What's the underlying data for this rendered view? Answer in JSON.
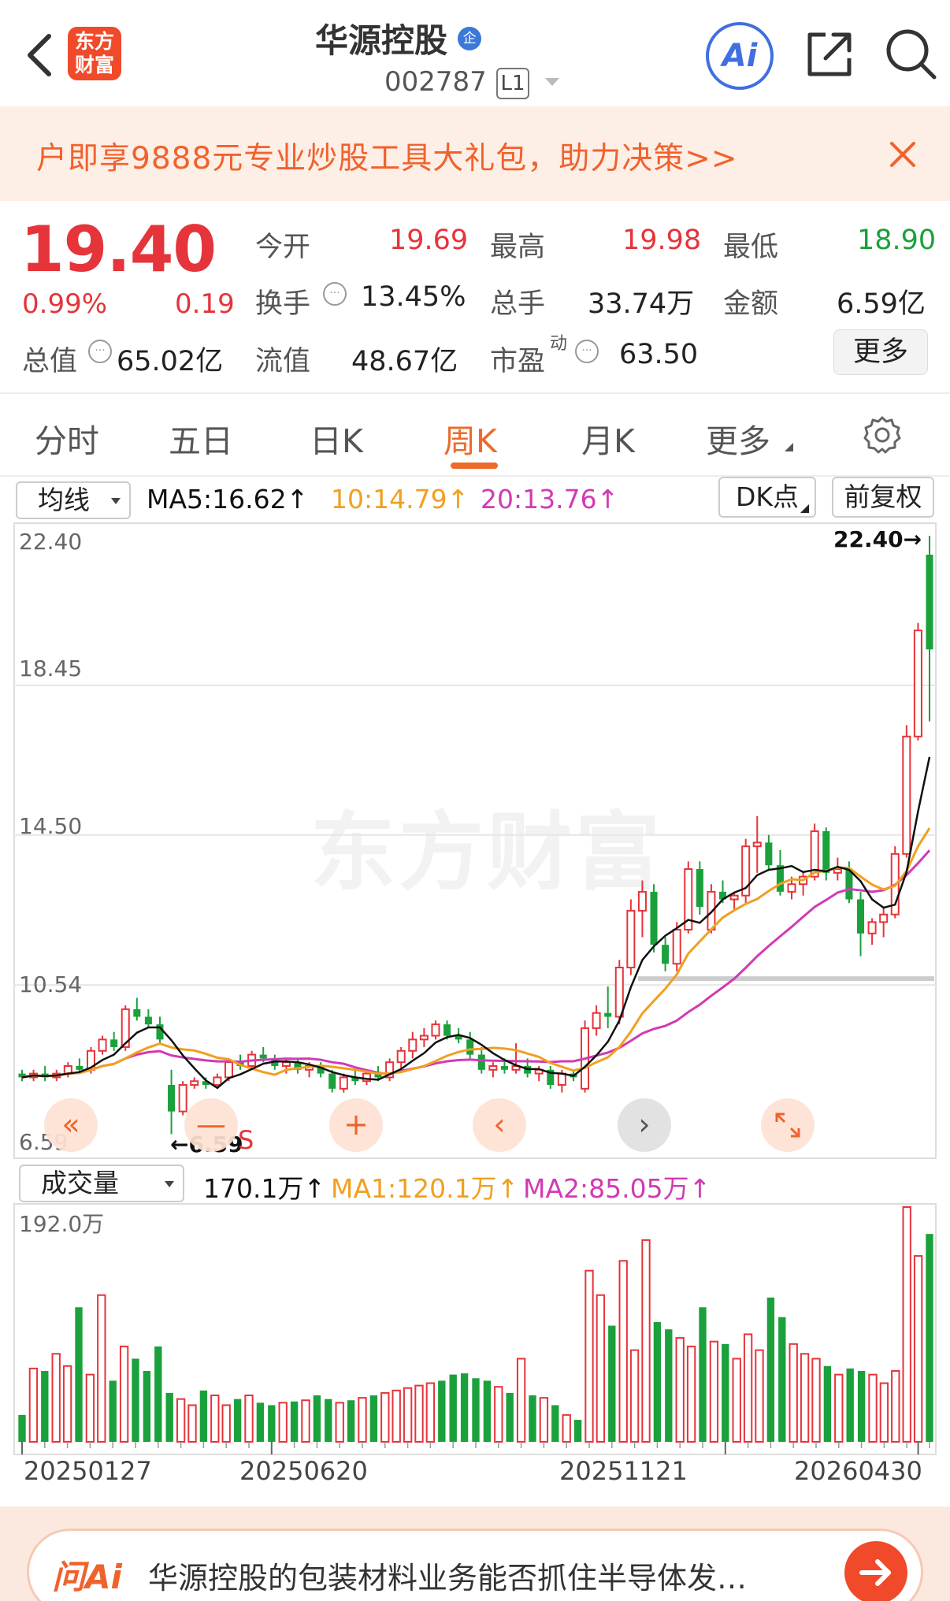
{
  "header": {
    "brand_line1": "东方",
    "brand_line2": "财富",
    "stock_name": "华源控股",
    "corp_badge": "企",
    "code": "002787",
    "level_badge": "L1",
    "ai_label": "Ai"
  },
  "promo": {
    "text": "户即享9888元专业炒股工具大礼包，助力决策>>"
  },
  "quote": {
    "price": "19.40",
    "change_pct": "0.99%",
    "change": "0.19",
    "open_label": "今开",
    "open": "19.69",
    "high_label": "最高",
    "high": "19.98",
    "low_label": "最低",
    "low": "18.90",
    "turnover_label": "换手",
    "turnover": "13.45%",
    "volume_label": "总手",
    "volume": "33.74万",
    "amount_label": "金额",
    "amount": "6.59亿",
    "mcap_label": "总值",
    "mcap": "65.02亿",
    "float_label": "流值",
    "float": "48.67亿",
    "pe_label": "市盈",
    "pe_sup": "动",
    "pe": "63.50",
    "more_label": "更多"
  },
  "tabs": [
    {
      "label": "分时",
      "active": false
    },
    {
      "label": "五日",
      "active": false
    },
    {
      "label": "日K",
      "active": false
    },
    {
      "label": "周K",
      "active": true
    },
    {
      "label": "月K",
      "active": false
    },
    {
      "label": "更多",
      "active": false
    }
  ],
  "ma_bar": {
    "selector": "均线",
    "ma5": "MA5:16.62↑",
    "ma10": "10:14.79↑",
    "ma20": "20:13.76↑",
    "dk_label": "DK点",
    "fq_label": "前复权"
  },
  "vol_bar": {
    "selector": "成交量",
    "vol": "170.1万↑",
    "ma1": "MA1:120.1万↑",
    "ma2": "MA2:85.05万↑"
  },
  "watermark": "东方财富",
  "controls": {
    "prev_fast": "«",
    "zoom_out": "—",
    "zoom_in": "+",
    "prev": "‹",
    "next": "›"
  },
  "colors": {
    "up": "#e5343a",
    "down": "#1aa13b",
    "accent": "#ec6b2b",
    "ma5": "#111111",
    "ma10": "#f0a020",
    "ma20": "#d23ab4"
  },
  "chart_data": [
    {
      "type": "candlestick",
      "title": "",
      "y_ticks": [
        "22.40",
        "18.45",
        "14.50",
        "10.54",
        "6.59"
      ],
      "ylim": [
        6.59,
        22.4
      ],
      "annotations": {
        "max_label": "22.40→",
        "min_label": "←6.59",
        "signal": "S"
      },
      "reference_line": 10.54,
      "series": [
        {
          "name": "MA5",
          "current": 16.62
        },
        {
          "name": "10",
          "current": 14.79
        },
        {
          "name": "20",
          "current": 13.76
        }
      ],
      "candles": [
        [
          8.2,
          8.3,
          8.0,
          8.1
        ],
        [
          8.1,
          8.3,
          8.0,
          8.2
        ],
        [
          8.2,
          8.4,
          8.0,
          8.1
        ],
        [
          8.1,
          8.3,
          8.0,
          8.2
        ],
        [
          8.2,
          8.5,
          8.1,
          8.4
        ],
        [
          8.4,
          8.6,
          8.2,
          8.3
        ],
        [
          8.3,
          8.9,
          8.2,
          8.8
        ],
        [
          8.8,
          9.2,
          8.7,
          9.1
        ],
        [
          9.1,
          9.3,
          8.8,
          8.9
        ],
        [
          8.9,
          10.0,
          8.8,
          9.9
        ],
        [
          9.9,
          10.2,
          9.6,
          9.7
        ],
        [
          9.7,
          9.9,
          9.4,
          9.5
        ],
        [
          9.5,
          9.7,
          9.0,
          9.1
        ],
        [
          7.9,
          8.3,
          6.6,
          7.2
        ],
        [
          7.2,
          8.0,
          7.1,
          7.9
        ],
        [
          7.9,
          8.1,
          7.8,
          8.0
        ],
        [
          8.0,
          8.1,
          7.8,
          7.9
        ],
        [
          7.9,
          8.2,
          7.8,
          8.1
        ],
        [
          8.1,
          8.6,
          8.0,
          8.5
        ],
        [
          8.5,
          8.7,
          8.3,
          8.4
        ],
        [
          8.4,
          8.8,
          8.3,
          8.7
        ],
        [
          8.7,
          8.9,
          8.5,
          8.6
        ],
        [
          8.6,
          8.7,
          8.3,
          8.4
        ],
        [
          8.4,
          8.6,
          8.2,
          8.5
        ],
        [
          8.5,
          8.6,
          8.2,
          8.3
        ],
        [
          8.3,
          8.5,
          8.1,
          8.4
        ],
        [
          8.4,
          8.5,
          8.1,
          8.2
        ],
        [
          8.2,
          8.3,
          7.7,
          7.8
        ],
        [
          7.8,
          8.2,
          7.7,
          8.1
        ],
        [
          8.1,
          8.3,
          7.9,
          8.0
        ],
        [
          8.0,
          8.3,
          7.9,
          8.2
        ],
        [
          8.2,
          8.4,
          8.0,
          8.1
        ],
        [
          8.1,
          8.6,
          8.0,
          8.5
        ],
        [
          8.5,
          8.9,
          8.3,
          8.8
        ],
        [
          8.8,
          9.3,
          8.6,
          9.1
        ],
        [
          9.1,
          9.4,
          8.9,
          9.2
        ],
        [
          9.2,
          9.6,
          9.1,
          9.5
        ],
        [
          9.5,
          9.6,
          9.1,
          9.2
        ],
        [
          9.2,
          9.4,
          9.0,
          9.1
        ],
        [
          9.1,
          9.3,
          8.6,
          8.7
        ],
        [
          8.7,
          8.9,
          8.2,
          8.3
        ],
        [
          8.3,
          8.5,
          8.1,
          8.4
        ],
        [
          8.4,
          8.6,
          8.2,
          8.3
        ],
        [
          8.3,
          9.0,
          8.2,
          8.4
        ],
        [
          8.4,
          8.6,
          8.1,
          8.2
        ],
        [
          8.2,
          8.4,
          8.0,
          8.3
        ],
        [
          8.3,
          8.4,
          7.8,
          7.9
        ],
        [
          7.9,
          8.3,
          7.7,
          8.2
        ],
        [
          8.2,
          8.3,
          8.0,
          8.1
        ],
        [
          7.8,
          9.6,
          7.7,
          9.4
        ],
        [
          9.4,
          10.0,
          9.2,
          9.8
        ],
        [
          9.8,
          10.5,
          9.4,
          9.7
        ],
        [
          9.7,
          11.2,
          9.5,
          11.0
        ],
        [
          11.0,
          12.8,
          10.8,
          12.5
        ],
        [
          12.5,
          13.3,
          11.8,
          13.0
        ],
        [
          13.0,
          13.2,
          11.4,
          11.6
        ],
        [
          11.6,
          11.8,
          10.9,
          11.1
        ],
        [
          11.1,
          12.2,
          10.9,
          12.0
        ],
        [
          12.0,
          13.8,
          11.9,
          13.6
        ],
        [
          13.6,
          13.8,
          12.4,
          12.6
        ],
        [
          12.0,
          13.2,
          11.9,
          13.0
        ],
        [
          13.0,
          13.3,
          12.7,
          12.8
        ],
        [
          12.8,
          13.0,
          12.5,
          12.9
        ],
        [
          12.9,
          14.4,
          12.7,
          14.2
        ],
        [
          14.2,
          15.0,
          13.5,
          14.3
        ],
        [
          14.3,
          14.5,
          13.6,
          13.7
        ],
        [
          13.7,
          14.1,
          12.9,
          13.0
        ],
        [
          13.0,
          13.4,
          12.8,
          13.2
        ],
        [
          13.2,
          13.5,
          12.9,
          13.4
        ],
        [
          13.4,
          14.8,
          13.3,
          14.6
        ],
        [
          14.6,
          14.7,
          13.3,
          13.5
        ],
        [
          13.5,
          13.9,
          13.3,
          13.6
        ],
        [
          13.6,
          13.8,
          12.7,
          12.8
        ],
        [
          12.8,
          13.0,
          11.3,
          11.9
        ],
        [
          11.9,
          12.3,
          11.6,
          12.2
        ],
        [
          12.2,
          12.6,
          11.8,
          12.4
        ],
        [
          12.4,
          14.2,
          12.3,
          14.0
        ],
        [
          14.0,
          17.4,
          13.9,
          17.1
        ],
        [
          17.1,
          20.1,
          17.0,
          19.9
        ],
        [
          21.9,
          22.4,
          17.5,
          19.4
        ]
      ]
    },
    {
      "type": "bar",
      "title": "",
      "y_ticks": [
        "192.0万"
      ],
      "ylim": [
        0,
        192.0
      ],
      "x_ticks": [
        "20250127",
        "20250620",
        "20251121",
        "20260430"
      ],
      "series": [
        {
          "name": "MA1",
          "current": 120.1
        },
        {
          "name": "MA2",
          "current": 85.05
        }
      ],
      "current_volume": 170.1,
      "volumes": [
        22,
        60,
        58,
        72,
        62,
        110,
        55,
        120,
        50,
        78,
        68,
        58,
        78,
        40,
        35,
        30,
        42,
        38,
        30,
        35,
        38,
        32,
        30,
        32,
        33,
        34,
        38,
        35,
        32,
        34,
        36,
        38,
        40,
        42,
        44,
        46,
        48,
        50,
        55,
        56,
        52,
        50,
        45,
        40,
        68,
        38,
        36,
        30,
        22,
        18,
        140,
        120,
        95,
        148,
        75,
        165,
        98,
        92,
        85,
        78,
        110,
        82,
        80,
        68,
        88,
        75,
        118,
        102,
        80,
        72,
        68,
        62,
        55,
        60,
        58,
        55,
        48,
        58,
        192,
        152,
        170
      ]
    }
  ]
}
